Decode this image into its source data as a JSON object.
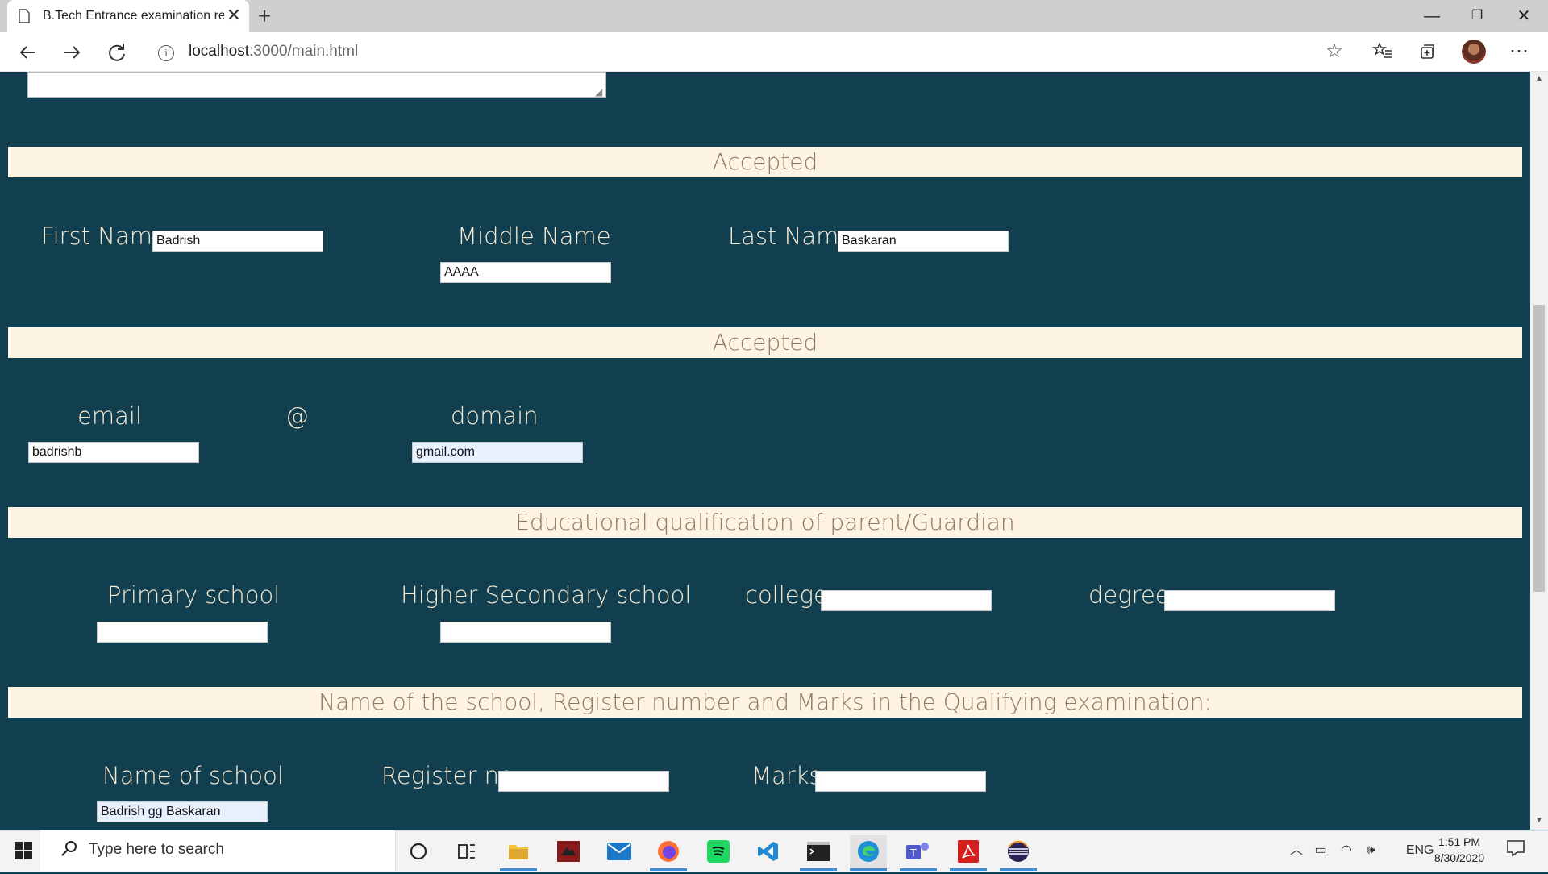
{
  "browser": {
    "tab_title": "B.Tech Entrance examination reg",
    "tab_close": "✕",
    "new_tab": "+",
    "url_host": "localhost",
    "url_path": ":3000/main.html",
    "window_controls": {
      "minimize": "—",
      "restore": "❐",
      "close": "✕"
    },
    "icons": [
      "back-icon",
      "forward-icon",
      "refresh-icon",
      "info-icon",
      "star-icon",
      "favorites-icon",
      "collections-icon",
      "profile-avatar",
      "more-icon"
    ]
  },
  "form": {
    "section1_status": "Accepted",
    "first_name_label": "First Name",
    "first_name_value": "Badrish",
    "middle_name_label": "Middle Name",
    "middle_name_value": "AAAA",
    "last_name_label": "Last Name",
    "last_name_value": "Baskaran",
    "section2_status": "Accepted",
    "email_label": "email",
    "at_label": "@",
    "domain_label": "domain",
    "email_value": "badrishb",
    "domain_value": "gmail.com",
    "section3_title": "Educational qualification of parent/Guardian",
    "primary_label": "Primary school",
    "primary_value": "",
    "higher_secondary_label": "Higher Secondary school",
    "higher_secondary_value": "",
    "college_label": "college",
    "college_value": "",
    "degree_label": "degree",
    "degree_value": "",
    "section4_title": "Name of the school, Register number and Marks in the Qualifying examination:",
    "school_name_label": "Name of school",
    "school_name_value": "Badrish gg Baskaran",
    "register_label": "Register no",
    "register_value": "",
    "marks_label": "Marks",
    "marks_value": ""
  },
  "taskbar": {
    "search_placeholder": "Type here to search",
    "language": "ENG",
    "time": "1:51 PM",
    "date": "8/30/2020"
  },
  "colors": {
    "page_bg": "#123f50",
    "banner_bg": "#fdf4e4",
    "banner_text": "#8e7a5d",
    "label_text": "#f7ead2"
  }
}
